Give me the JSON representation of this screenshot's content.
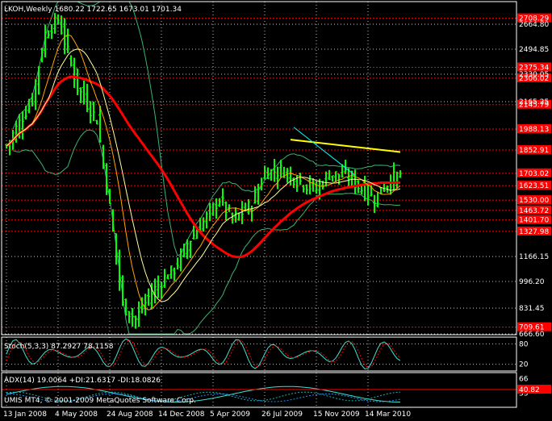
{
  "main_panel": {
    "info": "LKOH,Weekly  1680.22 1722.65 1673.01 1701.34",
    "y_ticks": [
      {
        "label": "2664.80",
        "v": 2664.8
      },
      {
        "label": "2494.85",
        "v": 2494.85
      },
      {
        "label": "2330.05",
        "v": 2330.05
      },
      {
        "label": "2165.25",
        "v": 2165.25
      },
      {
        "label": "1166.15",
        "v": 1166.15
      },
      {
        "label": "996.20",
        "v": 996.2
      },
      {
        "label": "831.45",
        "v": 831.45
      },
      {
        "label": "666.60",
        "v": 666.6
      }
    ],
    "levels": [
      {
        "label": "2708.29",
        "v": 2708.29
      },
      {
        "label": "2375.34",
        "v": 2375.34
      },
      {
        "label": "2306.02",
        "v": 2306.02
      },
      {
        "label": "2145.79",
        "v": 2145.79
      },
      {
        "label": "1988.13",
        "v": 1988.13
      },
      {
        "label": "1852.91",
        "v": 1852.91
      },
      {
        "label": "1703.02",
        "v": 1703.02
      },
      {
        "label": "1623.51",
        "v": 1623.51
      },
      {
        "label": "1530.00",
        "v": 1530.0
      },
      {
        "label": "1463.72",
        "v": 1463.72
      },
      {
        "label": "1401.70",
        "v": 1401.7
      },
      {
        "label": "1327.98",
        "v": 1327.98
      },
      {
        "label": "709.61",
        "v": 709.61
      }
    ]
  },
  "stoch_panel": {
    "info": "Stoch(5,3,3) 87.2927 78.1158",
    "ticks": [
      {
        "label": "80",
        "v": 80
      },
      {
        "label": "20",
        "v": 20
      }
    ]
  },
  "adx_panel": {
    "info": "ADX(14) 19.0064 +DI:21.6317 -DI:18.0826",
    "ticks": [
      {
        "label": "66",
        "v": 66
      },
      {
        "label": "33",
        "v": 33
      }
    ],
    "level": {
      "label": "40.82",
      "v": 40.82
    }
  },
  "copyright": "UMIS MT4, © 2001-2009 MetaQuotes Software Corp.",
  "x_ticks": [
    "13 Jan 2008",
    "4 May 2008",
    "24 Aug 2008",
    "14 Dec 2008",
    "5 Apr 2009",
    "26 Jul 2009",
    "15 Nov 2009",
    "14 Mar 2010"
  ],
  "colors": {
    "background": "#000000",
    "grid": "#c0c0c0",
    "bar": "#00ff00",
    "ma_long": "#ff0000",
    "ma_fast": "#ffa500",
    "ma_mid": "#ffffa0",
    "band": "#3cb371",
    "trend_yellow": "#ffff00",
    "trend_cyan": "#00ffff",
    "level": "#ff0000",
    "stoch_main": "#40e0d0",
    "stoch_signal": "#ff0000",
    "adx_main": "#40e0d0",
    "adx_plus": "#20b2aa",
    "adx_minus": "#1e90ff"
  },
  "chart_data": {
    "type": "line",
    "title": "LKOH,Weekly",
    "x": [
      "13 Jan 2008",
      "4 May 2008",
      "24 Aug 2008",
      "14 Dec 2008",
      "5 Apr 2009",
      "26 Jul 2009",
      "15 Nov 2009",
      "14 Mar 2010"
    ],
    "ylim": [
      666.6,
      2830
    ],
    "series": [
      {
        "name": "LKOH",
        "values": [
          1880,
          2700,
          1480,
          1000,
          1420,
          1710,
          1660,
          1701.34
        ]
      }
    ],
    "last_bar": {
      "open": 1680.22,
      "high": 1722.65,
      "low": 1673.01,
      "close": 1701.34
    },
    "grid": true,
    "legend": "top-left"
  }
}
